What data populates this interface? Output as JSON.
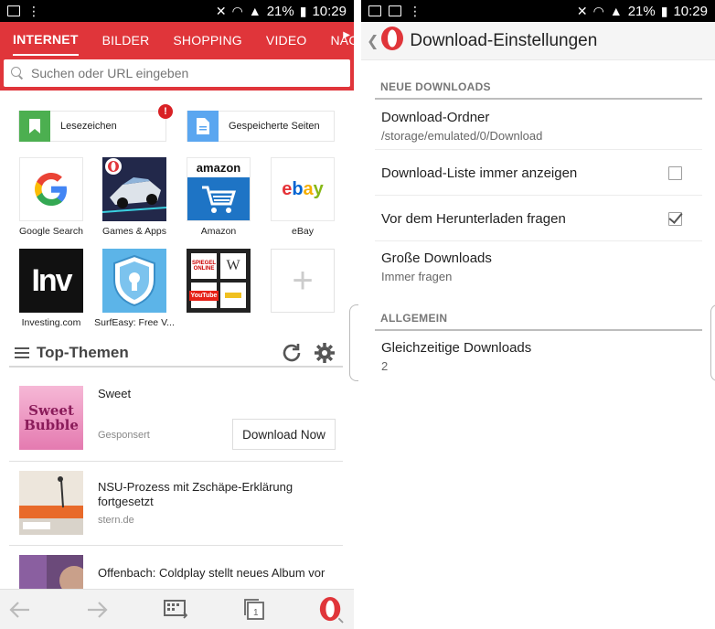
{
  "left": {
    "status": {
      "battery": "21%",
      "time": "10:29"
    },
    "tabs": [
      "INTERNET",
      "BILDER",
      "SHOPPING",
      "VIDEO",
      "NACHRICH"
    ],
    "search": {
      "placeholder": "Suchen oder URL eingeben"
    },
    "bookmarks_button": "Lesezeichen",
    "saved_pages_button": "Gespeicherte Seiten",
    "badge": "!",
    "speed_dials": [
      {
        "label": "Google Search"
      },
      {
        "label": "Games & Apps"
      },
      {
        "label": "Amazon",
        "logo_text": "amazon"
      },
      {
        "label": "eBay",
        "logo_text": "ebay"
      },
      {
        "label": "Investing.com",
        "logo_text": "Inv"
      },
      {
        "label": "SurfEasy: Free V..."
      },
      {
        "label": ""
      },
      {
        "label": ""
      }
    ],
    "folder_items": [
      "SPIEGEL ONLINE",
      "W",
      "YouTube",
      ""
    ],
    "top_themen": "Top-Themen",
    "news": [
      {
        "title": "Sweet",
        "source": "Gesponsert",
        "action": "Download Now",
        "thumb_text": "Sweet Bubble"
      },
      {
        "title": "NSU-Prozess mit Zschäpe-Erklärung fortgesetzt",
        "source": "stern.de"
      },
      {
        "title": "Offenbach: Coldplay stellt neues Album vor",
        "source": ""
      }
    ]
  },
  "right": {
    "status": {
      "battery": "21%",
      "time": "10:29"
    },
    "title": "Download-Einstellungen",
    "sections": {
      "new_downloads": "NEUE DOWNLOADS",
      "general": "ALLGEMEIN"
    },
    "settings": {
      "folder": {
        "label": "Download-Ordner",
        "value": "/storage/emulated/0/Download"
      },
      "always_show_list": {
        "label": "Download-Liste immer anzeigen",
        "checked": false
      },
      "ask_before": {
        "label": "Vor dem Herunterladen fragen",
        "checked": true
      },
      "large_downloads": {
        "label": "Große Downloads",
        "value": "Immer fragen"
      },
      "concurrent": {
        "label": "Gleichzeitige Downloads",
        "value": "2"
      }
    }
  },
  "colors": {
    "opera_red": "#e0353a",
    "accent_red": "#d92125"
  }
}
